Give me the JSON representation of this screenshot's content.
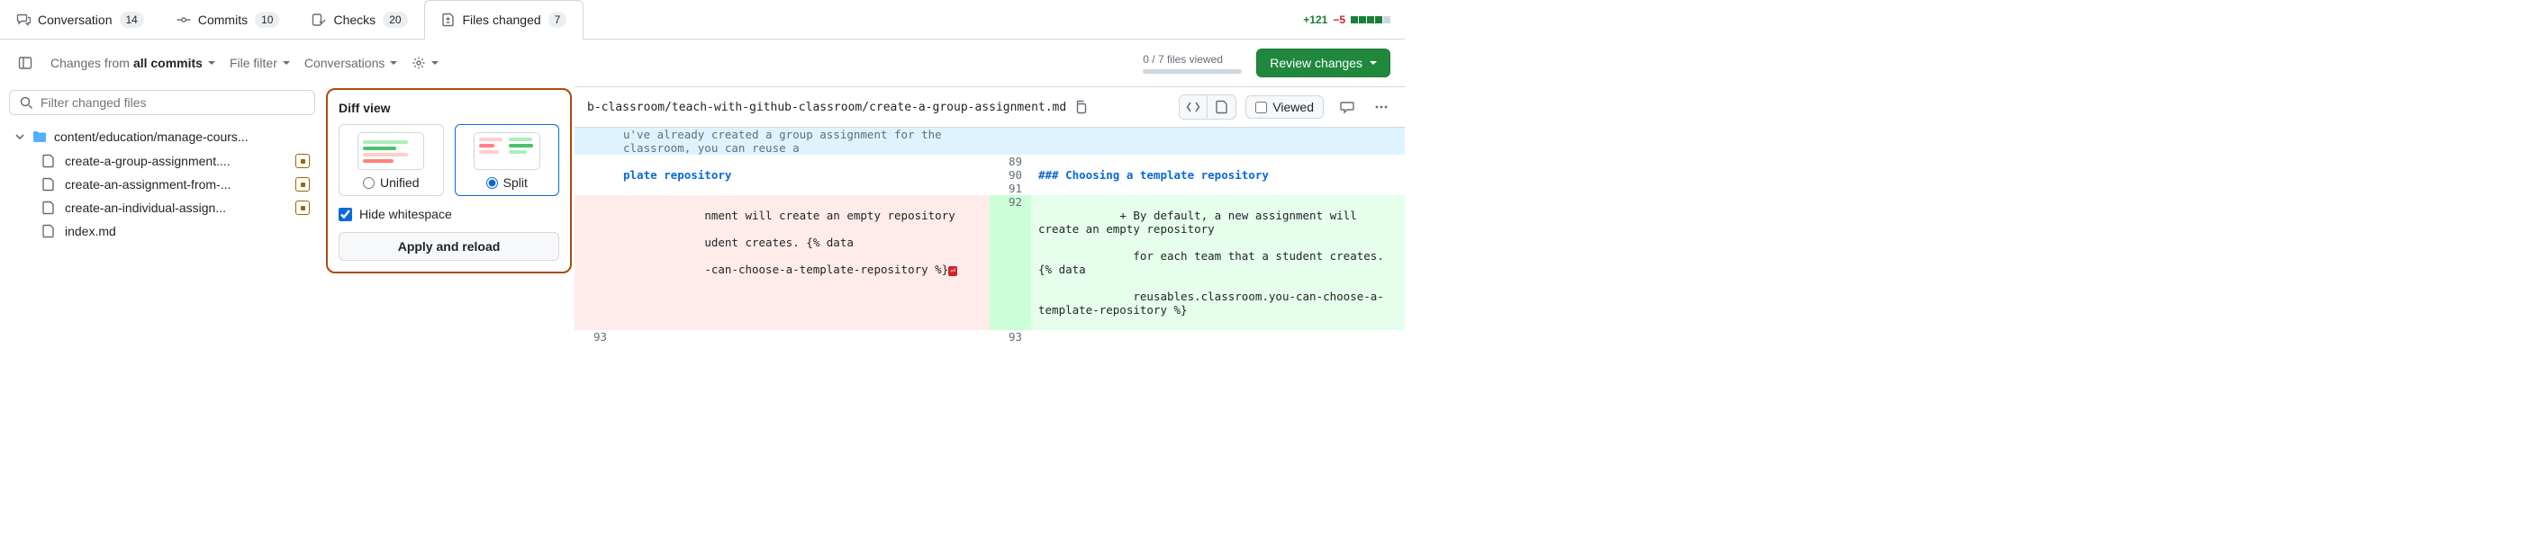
{
  "tabs": {
    "conversation": {
      "label": "Conversation",
      "count": "14"
    },
    "commits": {
      "label": "Commits",
      "count": "10"
    },
    "checks": {
      "label": "Checks",
      "count": "20"
    },
    "files": {
      "label": "Files changed",
      "count": "7"
    }
  },
  "diffstat": {
    "additions": "+121",
    "deletions": "−5"
  },
  "toolbar": {
    "changes_prefix": "Changes from ",
    "changes_value": "all commits",
    "file_filter": "File filter",
    "conversations": "Conversations",
    "viewed_summary": "0 / 7 files viewed",
    "review_changes": "Review changes"
  },
  "filter_placeholder": "Filter changed files",
  "tree": {
    "folder": "content/education/manage-cours...",
    "files": [
      {
        "name": "create-a-group-assignment....",
        "modified": true
      },
      {
        "name": "create-an-assignment-from-...",
        "modified": true
      },
      {
        "name": "create-an-individual-assign...",
        "modified": true
      },
      {
        "name": "index.md",
        "modified": false
      }
    ]
  },
  "popover": {
    "title": "Diff view",
    "unified_label": "Unified",
    "split_label": "Split",
    "hide_ws_label": "Hide whitespace",
    "apply_label": "Apply and reload"
  },
  "file_header": {
    "path_visible": "b-classroom/teach-with-github-classroom/create-a-group-assignment.md",
    "viewed_label": "Viewed"
  },
  "diff": {
    "hunk_text": "u've already created a group assignment for the classroom, you can reuse a",
    "heading_left": "plate repository",
    "heading_right": "### Choosing a template repository",
    "del_lines": [
      "nment will create an empty repository",
      "udent creates. {% data",
      "-can-choose-a-template-repository %}"
    ],
    "add_lines": [
      "By default, a new assignment will create an empty repository",
      "for each team that a student creates. {% data",
      "reusables.classroom.you-can-choose-a-template-repository %}"
    ],
    "right_nums": {
      "hunk": "",
      "blank1": "89",
      "head": "90",
      "blank2": "91",
      "add": "92",
      "last": "93"
    },
    "left_last": "93"
  }
}
